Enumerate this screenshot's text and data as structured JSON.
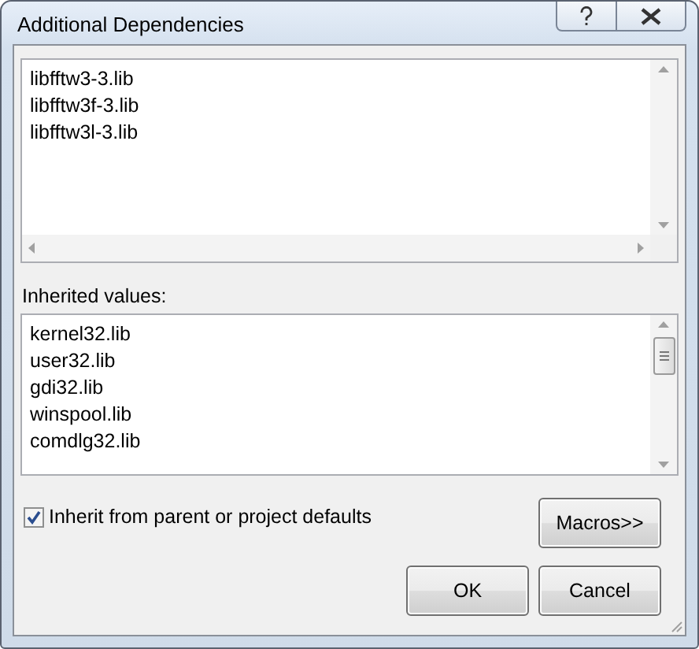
{
  "window": {
    "title": "Additional Dependencies"
  },
  "editor": {
    "lines": [
      "libfftw3-3.lib",
      "libfftw3f-3.lib",
      "libfftw3l-3.lib"
    ]
  },
  "inherited": {
    "label": "Inherited values:",
    "items": [
      "kernel32.lib",
      "user32.lib",
      "gdi32.lib",
      "winspool.lib",
      "comdlg32.lib"
    ]
  },
  "inherit_checkbox": {
    "label": "Inherit from parent or project defaults",
    "checked": true
  },
  "macros_button": "Macros>>",
  "buttons": [
    "OK",
    "Cancel"
  ]
}
